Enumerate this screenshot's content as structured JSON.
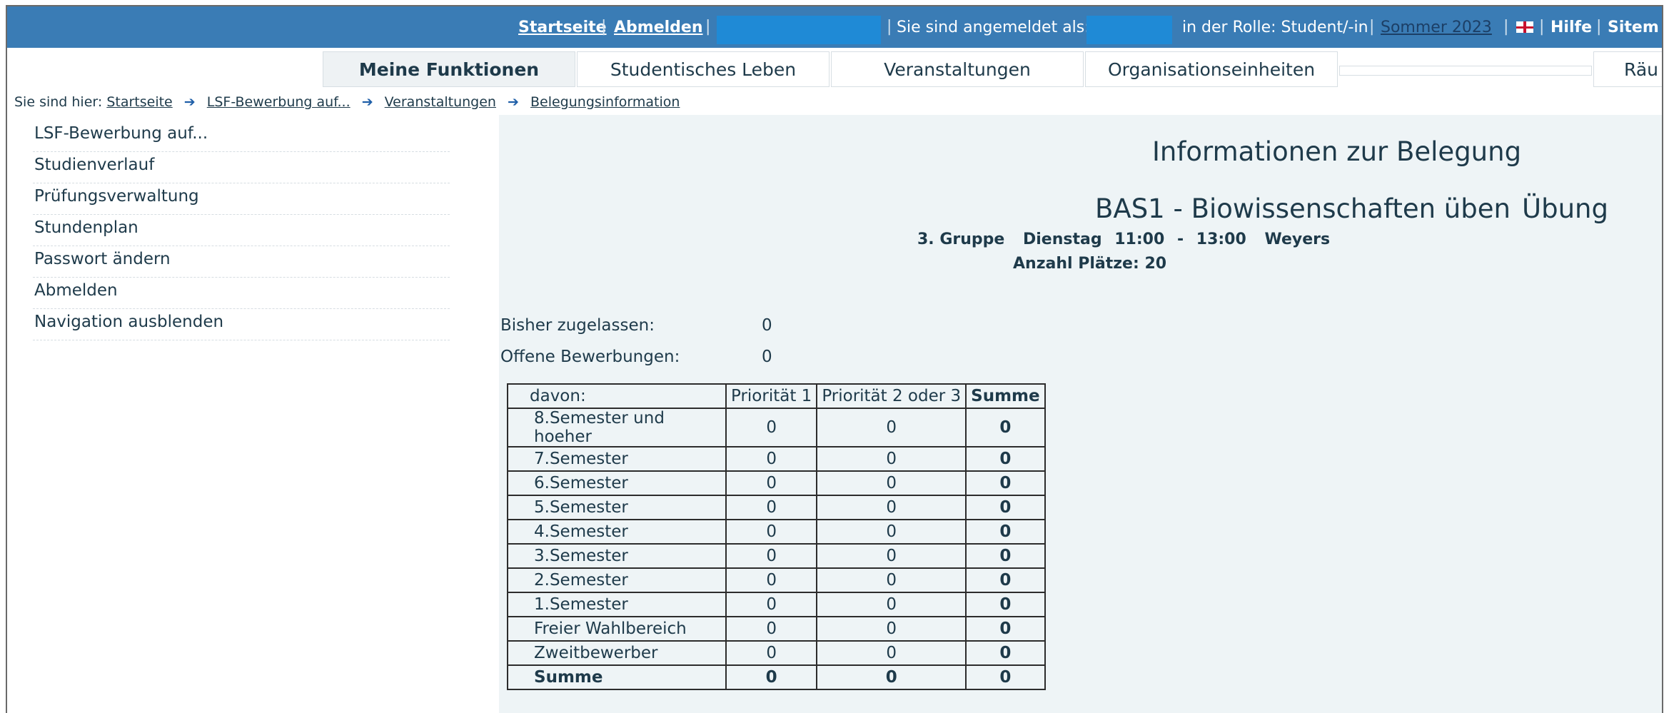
{
  "topbar": {
    "home": "Startseite",
    "logout": "Abmelden",
    "logged_in_as": "Sie sind angemeldet als:",
    "role": "in der Rolle: Student/-in",
    "semester": "Sommer 2023",
    "help": "Hilfe",
    "sitemap": "Sitem",
    "separator": "|",
    "redaction_color": "#1f8ad6",
    "bar_color": "#3a7cb5"
  },
  "tabs": [
    {
      "label": "Meine Funktionen",
      "active": true
    },
    {
      "label": "Studentisches Leben"
    },
    {
      "label": "Veranstaltungen"
    },
    {
      "label": "Organisationseinheiten"
    },
    {
      "label": ""
    },
    {
      "label": "Räu"
    }
  ],
  "breadcrumb": {
    "prefix": "Sie sind hier:",
    "items": [
      "Startseite",
      "LSF-Bewerbung auf...",
      "Veranstaltungen",
      "Belegungsinformation"
    ],
    "arrow": "➔"
  },
  "sidebar": {
    "items": [
      {
        "label": "LSF-Bewerbung auf..."
      },
      {
        "label": "Studienverlauf"
      },
      {
        "label": "Prüfungsverwaltung"
      },
      {
        "label": "Stundenplan"
      },
      {
        "label": "Passwort ändern"
      },
      {
        "label": "Abmelden"
      },
      {
        "label": "Navigation ausblenden"
      }
    ]
  },
  "main": {
    "heading": "Informationen zur Belegung",
    "course": "BAS1 - Biowissenschaften üben",
    "course_type": "Übung",
    "group": "3. Gruppe",
    "day": "Dienstag",
    "time_from": "11:00",
    "time_dash": "-",
    "time_to": "13:00",
    "lecturer": "Weyers",
    "places_label": "Anzahl Plätze:",
    "places": "20",
    "admitted_label": "Bisher zugelassen:",
    "admitted": "0",
    "open_label": "Offene Bewerbungen:",
    "open": "0"
  },
  "table": {
    "headers": [
      "davon:",
      "Priorität 1",
      "Priorität 2 oder 3",
      "Summe"
    ],
    "rows": [
      [
        "8.Semester und hoeher",
        "0",
        "0",
        "0"
      ],
      [
        "7.Semester",
        "0",
        "0",
        "0"
      ],
      [
        "6.Semester",
        "0",
        "0",
        "0"
      ],
      [
        "5.Semester",
        "0",
        "0",
        "0"
      ],
      [
        "4.Semester",
        "0",
        "0",
        "0"
      ],
      [
        "3.Semester",
        "0",
        "0",
        "0"
      ],
      [
        "2.Semester",
        "0",
        "0",
        "0"
      ],
      [
        "1.Semester",
        "0",
        "0",
        "0"
      ],
      [
        "Freier Wahlbereich",
        "0",
        "0",
        "0"
      ],
      [
        "Zweitbewerber",
        "0",
        "0",
        "0"
      ],
      [
        "Summe",
        "0",
        "0",
        "0"
      ]
    ]
  }
}
